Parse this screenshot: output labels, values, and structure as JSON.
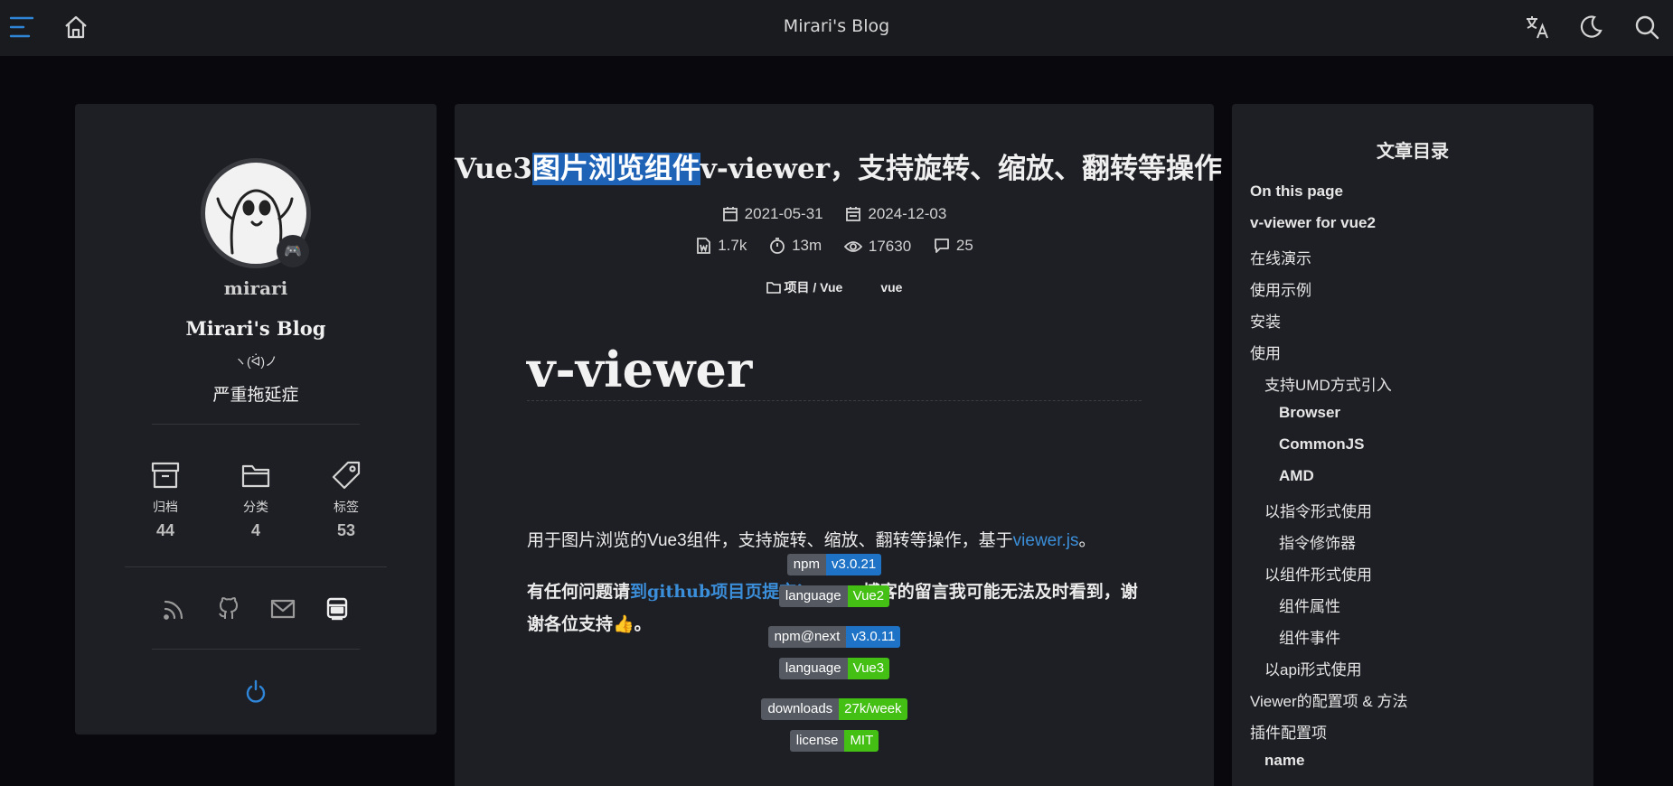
{
  "header": {
    "site_title": "Mirari's Blog"
  },
  "profile": {
    "name": "mirari",
    "blog_name": "Mirari's Blog",
    "kaomoji": "ヽ(ᐛ)ノ",
    "motto": "严重拖延症",
    "stats": [
      {
        "label": "归档",
        "count": "44"
      },
      {
        "label": "分类",
        "count": "4"
      },
      {
        "label": "标签",
        "count": "53"
      }
    ]
  },
  "article": {
    "title_prefix": "Vue3",
    "title_selected": "图片浏览组件",
    "title_suffix": "v-viewer，支持旋转、缩放、翻转等操作",
    "created": "2021-05-31",
    "updated": "2024-12-03",
    "words": "1.7k",
    "read_time": "13m",
    "views": "17630",
    "comments": "25",
    "category": "项目 / Vue",
    "tag": "vue",
    "heading": "v-viewer",
    "intro": "用于图片浏览的Vue3组件，支持旋转、缩放、翻转等操作，基于",
    "intro_link": "viewer.js",
    "intro_end": "。",
    "notice_pre": "有任何问题请",
    "notice_link": "到github项目页提交issue",
    "notice_post": "，博客的留言我可能无法及时看到，谢谢各位支持👍。",
    "badges": [
      {
        "key": "npm",
        "value": "v3.0.21",
        "color": "#1f73c7"
      },
      {
        "key": "language",
        "value": "Vue2",
        "color": "#44c015"
      },
      {
        "key": "npm@next",
        "value": "v3.0.11",
        "color": "#1f73c7"
      },
      {
        "key": "language",
        "value": "Vue3",
        "color": "#44c015"
      },
      {
        "key": "downloads",
        "value": "27k/week",
        "color": "#44c015"
      },
      {
        "key": "license",
        "value": "MIT",
        "color": "#44c015"
      }
    ]
  },
  "toc": {
    "title": "文章目录",
    "items": [
      "On this page",
      "v-viewer for vue2",
      "在线演示",
      "使用示例",
      "安装",
      "使用",
      "支持UMD方式引入",
      "Browser",
      "CommonJS",
      "AMD",
      "以指令形式使用",
      "指令修饰器",
      "以组件形式使用",
      "组件属性",
      "组件事件",
      "以api形式使用",
      "Viewer的配置项 & 方法",
      "插件配置项",
      "name"
    ]
  },
  "colors": {
    "accent": "#1f73c7",
    "link": "#3b8ed9",
    "selection": "#1f63b7",
    "badge_green": "#44c015"
  }
}
